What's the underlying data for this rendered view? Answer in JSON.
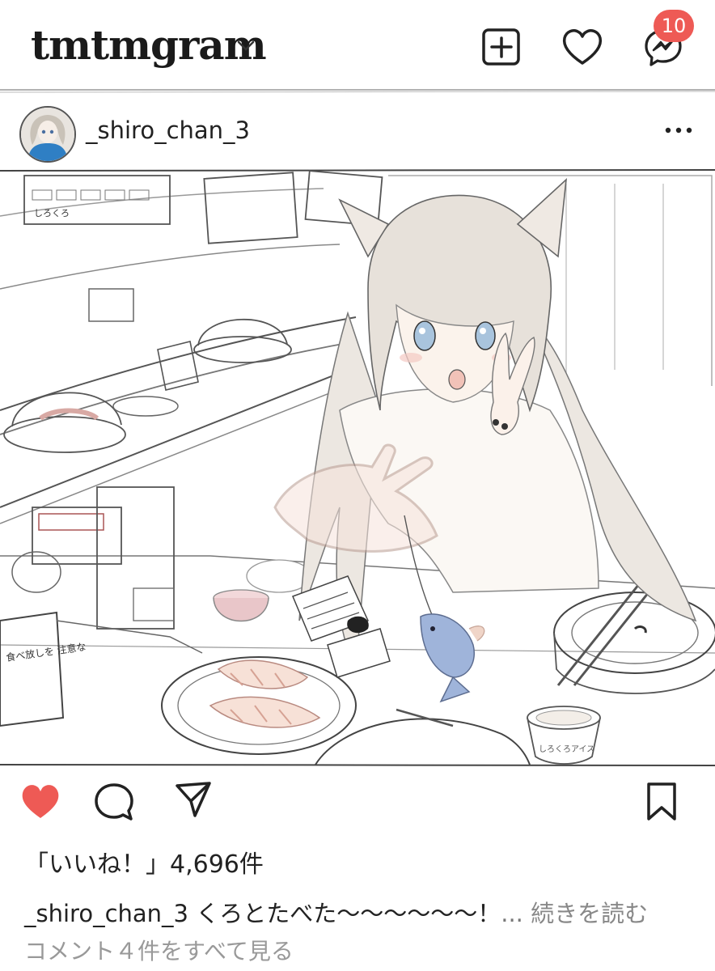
{
  "header": {
    "brand": "tmtmgram",
    "notification_count": "10",
    "icons": [
      "chevron-down-icon",
      "new-post-icon",
      "heart-icon",
      "messenger-icon"
    ]
  },
  "post": {
    "username": "_shiro_chan_3",
    "likes_text": "「いいね！」4,696件",
    "caption": {
      "username": "_shiro_chan_3",
      "text": "くろとたべた〜〜〜〜〜〜！",
      "ellipsis": "...",
      "more_label": "続きを読む"
    },
    "view_comments": "コメント４件をすべて見る"
  },
  "artwork": {
    "sign_left_1": "しろくろ",
    "sign_left_2": "食べ放しを 注意な",
    "sign_right": "しろくろアイス"
  },
  "colors": {
    "like_active": "#ee5a55",
    "badge": "#ee5a55",
    "ink": "#222222"
  }
}
